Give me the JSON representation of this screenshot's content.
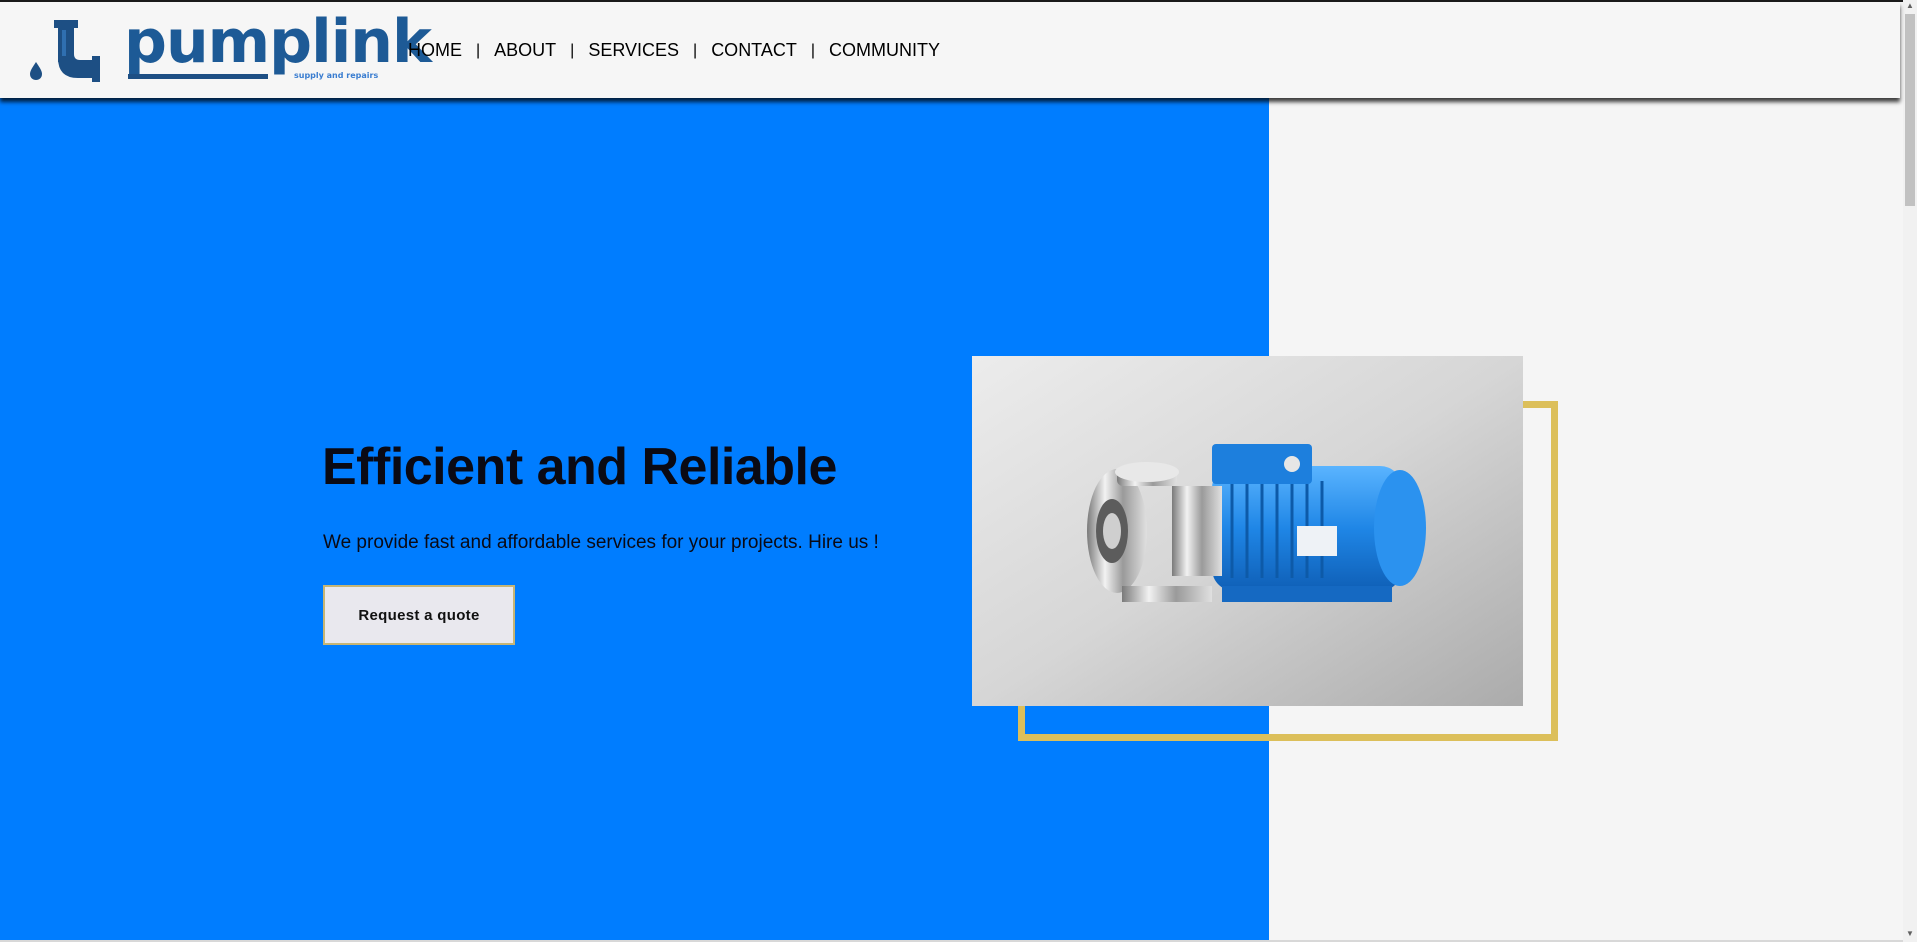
{
  "brand": {
    "name": "pumplink",
    "tagline": "supply and repairs",
    "logo_icon": "pipe-drop-icon",
    "primary_color": "#1d5a96"
  },
  "nav": {
    "items": [
      {
        "label": "HOME"
      },
      {
        "label": "ABOUT"
      },
      {
        "label": "SERVICES"
      },
      {
        "label": "CONTACT"
      },
      {
        "label": "COMMUNITY"
      }
    ],
    "separator": "|"
  },
  "hero": {
    "title": "Efficient and Reliable",
    "subtitle": "We provide fast and affordable services for your projects. Hire us !",
    "cta_label": "Request a quote",
    "image_subject": "centrifugal-pump-image",
    "colors": {
      "background": "#007dff",
      "accent_frame": "#dcbf5a",
      "right_panel": "#f5f5f5"
    }
  }
}
